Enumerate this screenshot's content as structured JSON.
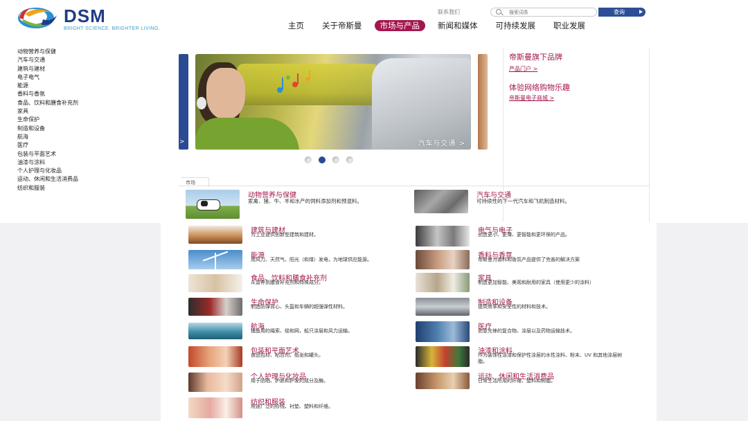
{
  "header": {
    "brand_name": "DSM",
    "brand_tagline": "BRIGHT SCIENCE. BRIGHTER LIVING.",
    "contact_link": "联系我们",
    "search_placeholder": "搜索词条",
    "search_button": "查询",
    "brand_colors": {
      "navy": "#1f3c86",
      "accent": "#a4174e",
      "cyan": "#3d9ad1"
    }
  },
  "nav": {
    "items": [
      {
        "label": "主页",
        "active": false
      },
      {
        "label": "关于帝斯曼",
        "active": false
      },
      {
        "label": "市场与产品",
        "active": true
      },
      {
        "label": "新闻和媒体",
        "active": false
      },
      {
        "label": "可持续发展",
        "active": false
      },
      {
        "label": "职业发展",
        "active": false
      }
    ]
  },
  "side_menu": {
    "items": [
      "动物营养与保健",
      "汽车与交通",
      "建筑与建材",
      "电子电气",
      "能源",
      "香料与香氛",
      "食品、饮料和膳食补充剂",
      "家具",
      "生命保护",
      "制造和设备",
      "航海",
      "医疗",
      "包装与平面艺术",
      "油漆与涂料",
      "个人护理与化妆品",
      "运动、休闲和生活消费品",
      "纺织和服装"
    ]
  },
  "carousel": {
    "caption": "汽车与交通 >",
    "prev_arrow": ">",
    "slide_count": 4,
    "active_index": 1
  },
  "right_panel": {
    "brands_heading": "帝斯曼旗下品牌",
    "brands_link": "产品门户 >",
    "shop_heading": "体验网络购物乐趣",
    "shop_link": "帝斯曼电子商城 >"
  },
  "markets": {
    "tab_label": "市场",
    "featured": [
      {
        "title": "动物营养与保健",
        "desc": "家禽、猪、牛、羊和水产的饲料添加剂和预混料。",
        "icon": "cow-photo"
      },
      {
        "title": "汽车与交通",
        "desc": "可持续性的下一代汽车和飞机制造材料。",
        "icon": "car-interior-photo"
      }
    ],
    "left": [
      {
        "title": "建筑与建材",
        "desc": "为工业提供创新型建筑和建材。",
        "icon": "buildings-photo"
      },
      {
        "title": "能源",
        "desc": "用风力、天然气、阳光（和煤）发电，为地球供应能源。",
        "icon": "wind-turbine-photo"
      },
      {
        "title": "食品、饮料和膳食补充剂",
        "desc": "从营养到膳食补充剂和特殊成分。",
        "icon": "food-photo"
      },
      {
        "title": "生命保护",
        "desc": "制造防弹背心、头盔和车辆的超强弹性材料。",
        "icon": "protection-photo"
      },
      {
        "title": "航海",
        "desc": "捕鱼用的绳索、缆和网，船只涂层和风力运输。",
        "icon": "sea-photo"
      },
      {
        "title": "包装和平面艺术",
        "desc": "食品包材、粘合剂、纸张和罐头。",
        "icon": "packaging-photo"
      },
      {
        "title": "个人护理与化妆品",
        "desc": "用于防晒、护肤和护发的成分及酶。",
        "icon": "cosmetics-photo"
      },
      {
        "title": "纺织和服装",
        "desc": "用途广泛的纱线、衬垫、塑料和纤维。",
        "icon": "textile-photo"
      }
    ],
    "right": [
      {
        "title": "电气与电子",
        "desc": "创造更小、更薄、更智能和更环保的产品。",
        "icon": "electronics-photo"
      },
      {
        "title": "香料与香氛",
        "desc": "帝斯曼为香料和香氛产品提供了完善的解决方案",
        "icon": "fragrance-photo"
      },
      {
        "title": "家具",
        "desc": "制造更加智能、美观和耐用的家具（使用更少的涂料）",
        "icon": "furniture-photo"
      },
      {
        "title": "制造和设备",
        "desc": "提高效率和安全性的材料和技术。",
        "icon": "factory-photo"
      },
      {
        "title": "医疗",
        "desc": "创意先锋的复合物、涂层以及药物运输技术。",
        "icon": "medical-photo"
      },
      {
        "title": "油漆和涂料",
        "desc": "作为装饰性涂漆和保护性涂层的水性涂料、粉末、UV 和其他涂层树脂。",
        "icon": "paint-photo"
      },
      {
        "title": "运动、休闲和生活消费品",
        "desc": "日常生活所用的纤维、塑料和树脂。",
        "icon": "sports-photo"
      }
    ]
  }
}
